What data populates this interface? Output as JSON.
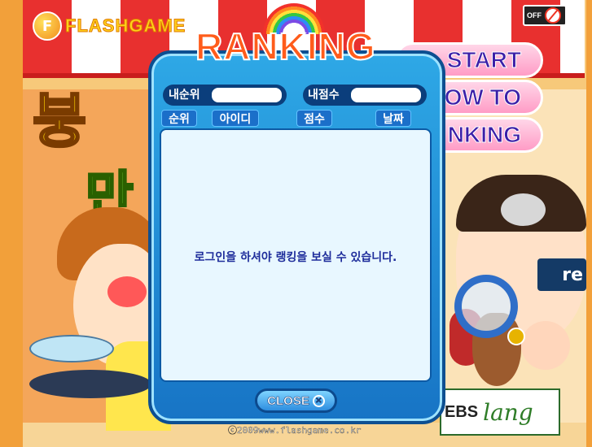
{
  "header": {
    "logo_text": "FLASHGAME",
    "sound_toggle_label": "OFF"
  },
  "game_title_fragments": [
    "붕",
    "만"
  ],
  "menu": {
    "start": "START",
    "how_to": "OW TO",
    "ranking": "NKING"
  },
  "ranking_dialog": {
    "title": "RANKING",
    "my_rank_label": "내순위",
    "my_rank_value": "",
    "my_score_label": "내점수",
    "my_score_value": "",
    "columns": [
      "순위",
      "아이디",
      "점수",
      "날짜"
    ],
    "empty_message": "로그인을 하셔야 랭킹을 보실 수 있습니다.",
    "close_label": "CLOSE"
  },
  "sign_partial": "re",
  "footer": {
    "copyright": "ⓒ2009www.flashgame.co.kr",
    "sponsor": "EBS",
    "sponsor_script": "lang"
  },
  "colors": {
    "dialog_blue": "#1774c5",
    "title_orange": "#ff5c1b",
    "menu_pink": "#ff9cc6",
    "message_text": "#1e2d9b"
  }
}
